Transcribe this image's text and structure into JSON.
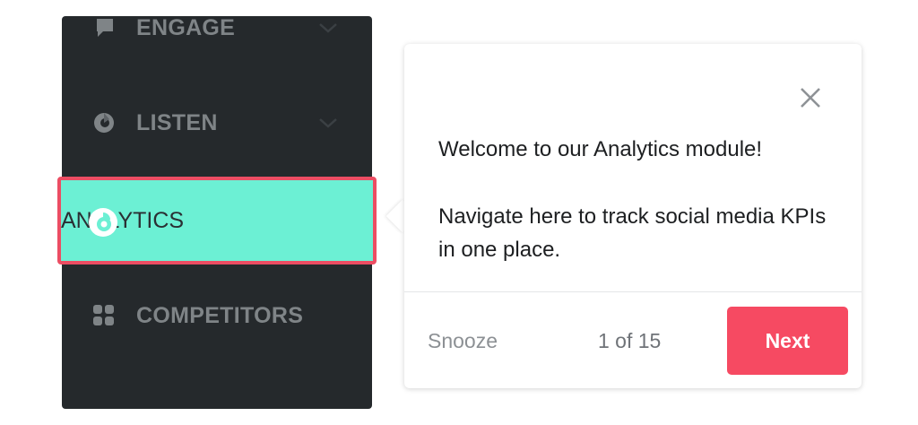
{
  "sidebar": {
    "items": [
      {
        "label": "ENGAGE",
        "icon": "speech-bubble-icon",
        "expandable": true
      },
      {
        "label": "LISTEN",
        "icon": "listen-icon",
        "expandable": true
      },
      {
        "label": "ANALYTICS",
        "icon": "analytics-icon",
        "active": true
      },
      {
        "label": "COMPETITORS",
        "icon": "grid-icon",
        "expandable": false
      }
    ]
  },
  "tour": {
    "message_line1": "Welcome to our Analytics module!",
    "message_line2": "Navigate here to track social media KPIs in one place.",
    "snooze_label": "Snooze",
    "progress": "1 of 15",
    "next_label": "Next",
    "close_icon": "close-icon"
  },
  "colors": {
    "sidebar_bg": "#25292c",
    "active_bg": "#6cf0d4",
    "highlight_border": "#ec4d63",
    "next_button": "#f64a62",
    "inactive_label": "#7f8487"
  }
}
